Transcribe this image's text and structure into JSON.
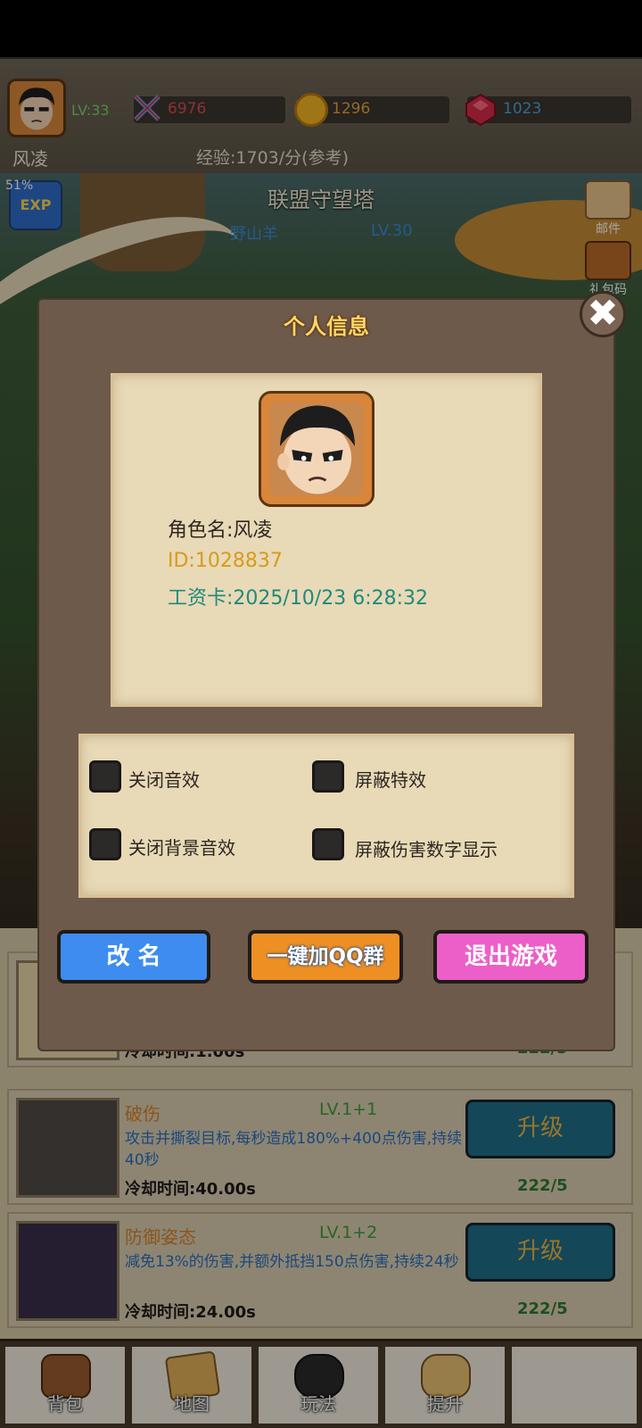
{
  "header": {
    "level": "LV:33",
    "power": "6976",
    "gold": "1296",
    "gems": "1023",
    "player_name": "风凌",
    "exp_rate": "经验:1703/分(参考)"
  },
  "scene": {
    "exp_percent": "51%",
    "exp_badge": "EXP",
    "map_title": "联盟守望塔",
    "boss_name": "野山羊",
    "boss_level": "LV.30",
    "side_icons": [
      "邮件",
      "礼包码"
    ]
  },
  "modal": {
    "title": "个人信息",
    "close_glyph": "✖",
    "role_name": "角色名:风凌",
    "player_id": "ID:1028837",
    "salary_card": "工资卡:2025/10/23 6:28:32",
    "settings": [
      {
        "label": "关闭音效",
        "checked": false
      },
      {
        "label": "屏蔽特效",
        "checked": false
      },
      {
        "label": "关闭背景音效",
        "checked": false
      },
      {
        "label": "屏蔽伤害数字显示",
        "checked": false
      }
    ],
    "buttons": {
      "rename": "改 名",
      "join_qq": "一键加QQ群",
      "exit": "退出游戏"
    }
  },
  "skills": [
    {
      "name": "",
      "level": "",
      "desc": "",
      "cooldown": "冷却时间:1.00s",
      "cost": "222/5",
      "upgrade": ""
    },
    {
      "name": "破伤",
      "level": "LV.1+1",
      "desc": "攻击并撕裂目标,每秒造成180%+400点伤害,持续40秒",
      "cooldown": "冷却时间:40.00s",
      "cost": "222/5",
      "upgrade": "升级"
    },
    {
      "name": "防御姿态",
      "level": "LV.1+2",
      "desc": "减免13%的伤害,并额外抵挡150点伤害,持续24秒",
      "cooldown": "冷却时间:24.00s",
      "cost": "222/5",
      "upgrade": "升级"
    }
  ],
  "nav": {
    "items": [
      {
        "label": "背包",
        "icon": "bag-icon"
      },
      {
        "label": "地图",
        "icon": "map-icon"
      },
      {
        "label": "玩法",
        "icon": "gamepad-icon"
      },
      {
        "label": "提升",
        "icon": "fist-icon"
      }
    ]
  },
  "colors": {
    "modal_bg": "#6e5a4a",
    "parchment": "#e8d9b7",
    "title_gold": "#ffd76a",
    "rename_blue": "#3e8cf0",
    "qq_orange": "#ee8f23",
    "exit_pink": "#ec5fc8"
  }
}
